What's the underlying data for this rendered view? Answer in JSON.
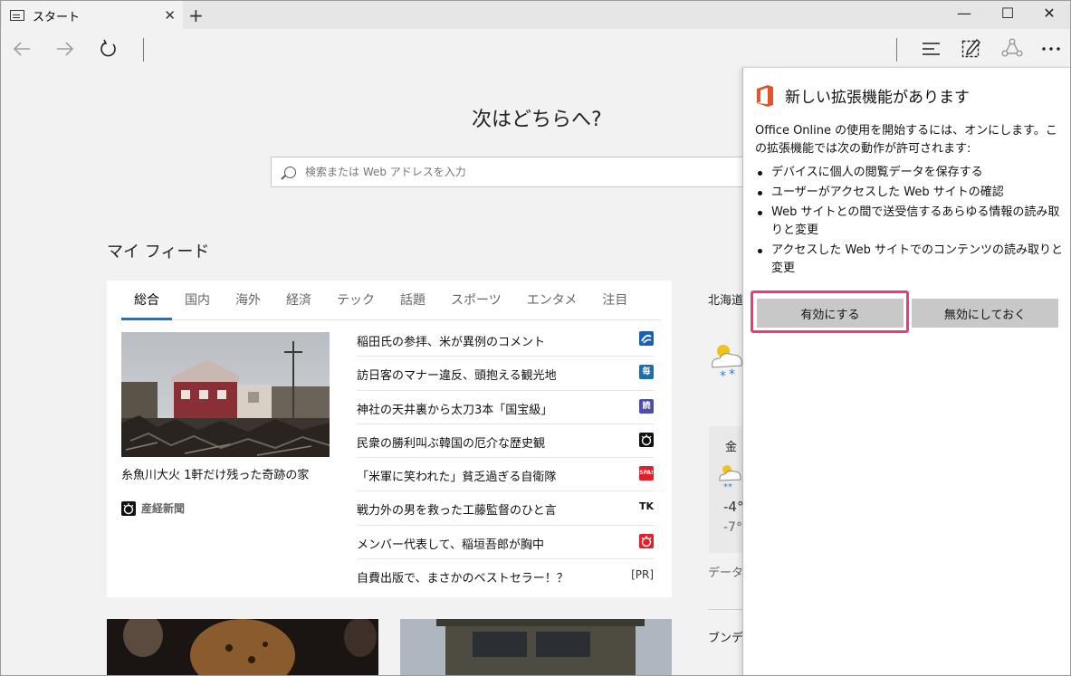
{
  "tab": {
    "title": "スタート",
    "close": "✕",
    "new_tab": "+"
  },
  "window": {
    "minimize": "—",
    "maximize": "☐",
    "close": "✕"
  },
  "page": {
    "heading": "次はどちらへ?",
    "search_placeholder": "検索または Web アドレスを入力",
    "feed_title": "マイ フィード"
  },
  "feed": {
    "tabs": [
      {
        "label": "総合"
      },
      {
        "label": "国内"
      },
      {
        "label": "海外"
      },
      {
        "label": "経済"
      },
      {
        "label": "テック"
      },
      {
        "label": "話題"
      },
      {
        "label": "スポーツ"
      },
      {
        "label": "エンタメ"
      },
      {
        "label": "注目"
      }
    ],
    "hero": {
      "caption": "糸魚川大火 1軒だけ残った奇跡の家",
      "source": "産経新聞"
    },
    "headlines": [
      {
        "text": "稲田氏の参拝、米が異例のコメント",
        "badge_color": "#1a5fb4"
      },
      {
        "text": "訪日客のマナー違反、頭抱える観光地",
        "badge": "毎",
        "badge_color": "#1b6ea8"
      },
      {
        "text": "神社の天井裏から太刀3本「国宝級」",
        "badge": "読",
        "badge_color": "#4b4fa8"
      },
      {
        "text": "民衆の勝利叫ぶ韓国の厄介な歴史観",
        "badge_color": "#111111"
      },
      {
        "text": "「米軍に笑われた」貧乏過ぎる自衛隊",
        "badge": "SPA!",
        "badge_color": "#e0202a"
      },
      {
        "text": "戦力外の男を救った工藤監督のひと言",
        "badge": "TK",
        "badge_color": "#ffffff"
      },
      {
        "text": "メンバー代表して、稲垣吾郎が胸中",
        "badge_color": "#e0202a"
      },
      {
        "text": "自費出版で、まさかのベストセラー！？",
        "pr": "[PR]"
      }
    ]
  },
  "weather": {
    "location": "北海道",
    "day": "金",
    "high": "-4°",
    "low": "-7°",
    "data_label": "データ",
    "bundes": "ブンデ"
  },
  "flyout": {
    "title": "新しい拡張機能があります",
    "description": "Office Online の使用を開始するには、オンにします。この拡張機能では次の動作が許可されます:",
    "permissions": [
      "デバイスに個人の閲覧データを保存する",
      "ユーザーがアクセスした Web サイトの確認",
      "Web サイトとの間で送受信するあらゆる情報の読み取りと変更",
      "アクセスした Web サイトでのコンテンツの読み取りと変更"
    ],
    "enable_label": "有効にする",
    "disable_label": "無効にしておく"
  }
}
